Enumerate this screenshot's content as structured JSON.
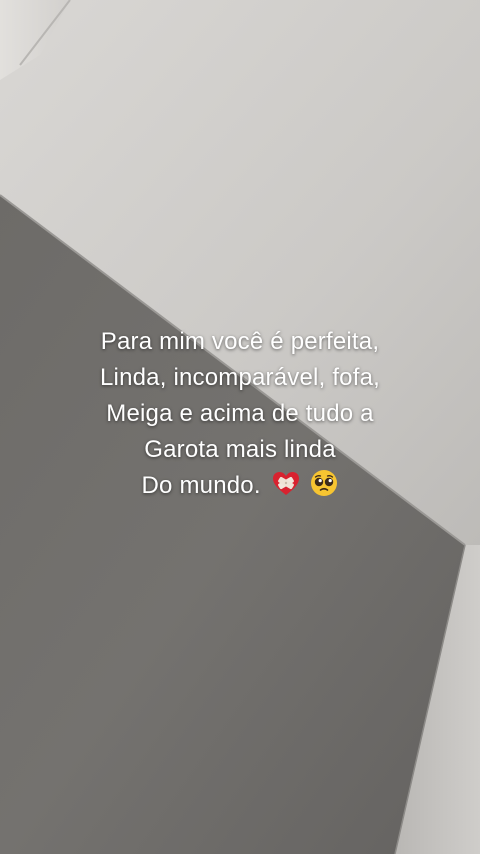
{
  "story": {
    "caption_lines": [
      "Para mim você é perfeita,",
      "Linda, incomparável, fofa,",
      "Meiga e acima de tudo a",
      "Garota mais linda",
      "Do mundo."
    ],
    "emojis": [
      "mending-heart-icon",
      "pleading-face-icon"
    ]
  },
  "colors": {
    "ceiling": "#cfcdca",
    "wall_dark": "#6f6d6a",
    "wall_light": "#c2c0bd",
    "caption_text": "#ffffff"
  }
}
